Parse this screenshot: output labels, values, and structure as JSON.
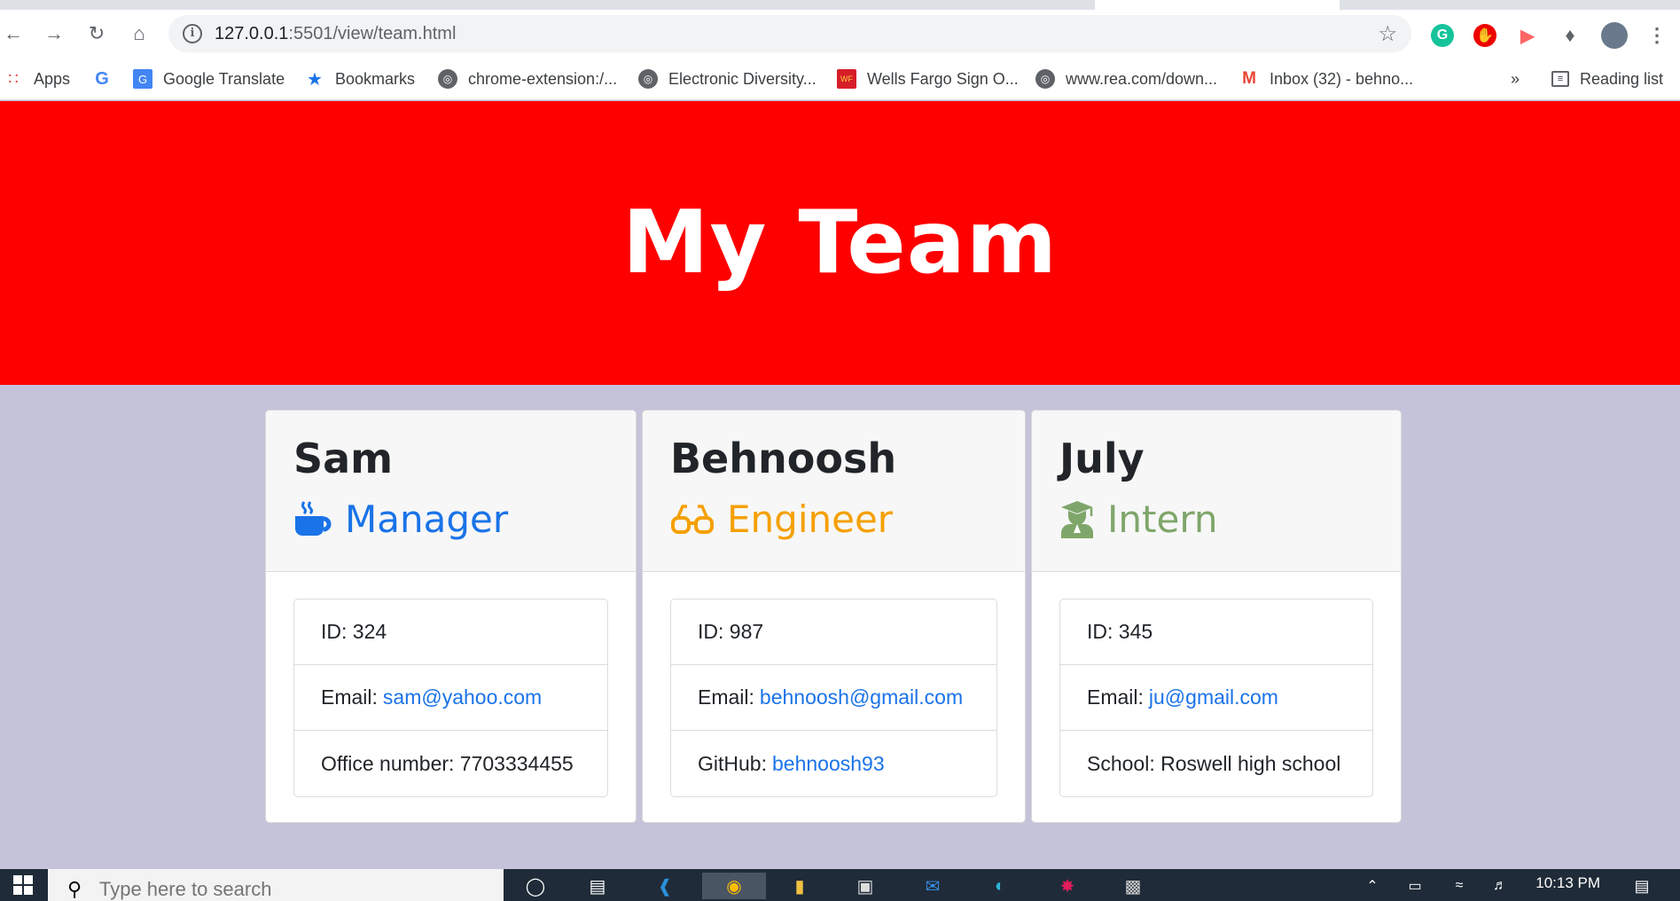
{
  "browser": {
    "url_host": "127.0.0.1",
    "url_path": ":5501/view/team.html",
    "bookmarks": [
      {
        "label": "Apps",
        "icon": "apps-grid-icon"
      },
      {
        "label": "",
        "icon": "google-icon"
      },
      {
        "label": "Google Translate",
        "icon": "google-translate-icon"
      },
      {
        "label": "Bookmarks",
        "icon": "star-icon"
      },
      {
        "label": "chrome-extension:/...",
        "icon": "globe-icon"
      },
      {
        "label": "Electronic Diversity...",
        "icon": "globe-icon"
      },
      {
        "label": "Wells Fargo Sign O...",
        "icon": "wells-fargo-icon"
      },
      {
        "label": "www.rea.com/down...",
        "icon": "globe-icon"
      },
      {
        "label": "Inbox (32) - behno...",
        "icon": "gmail-icon"
      }
    ],
    "overflow": "»",
    "reading_list": "Reading list"
  },
  "page": {
    "title": "My Team"
  },
  "team": [
    {
      "name": "Sam",
      "role": "Manager",
      "role_color": "#1a73e8",
      "icon": "coffee-mug-icon",
      "id_label": "ID: 324",
      "email_label": "Email:",
      "email": "sam@yahoo.com",
      "extra_label": "Office number: 7703334455",
      "extra_link": ""
    },
    {
      "name": "Behnoosh",
      "role": "Engineer",
      "role_color": "#f5a000",
      "icon": "glasses-icon",
      "id_label": "ID: 987",
      "email_label": "Email:",
      "email": "behnoosh@gmail.com",
      "extra_label": "GitHub:",
      "extra_link": "behnoosh93"
    },
    {
      "name": "July",
      "role": "Intern",
      "role_color": "#7fa66a",
      "icon": "graduate-icon",
      "id_label": "ID: 345",
      "email_label": "Email:",
      "email": "ju@gmail.com",
      "extra_label": "School: Roswell high school",
      "extra_link": ""
    }
  ],
  "taskbar": {
    "search_placeholder": "Type here to search",
    "time": "10:13 PM"
  }
}
